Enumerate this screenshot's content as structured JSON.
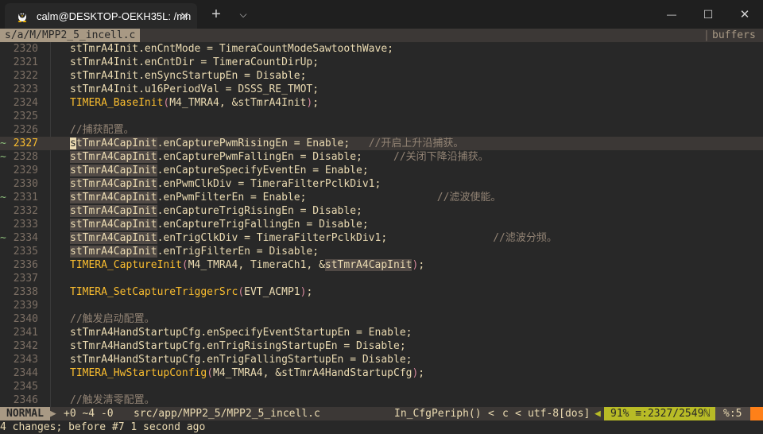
{
  "window": {
    "tab_title": "calm@DESKTOP-OEKH35L: /mn",
    "tab_close": "✕",
    "new_tab": "+",
    "dropdown": "⌵",
    "minimize": "—",
    "maximize": "☐",
    "close": "✕"
  },
  "tabline": {
    "buffer_name": "s/a/M/MPP2_5_incell.c",
    "separator": "|",
    "buffers_label": "buffers"
  },
  "lines": [
    {
      "num": "2320",
      "sign": "",
      "text": "stTmrA4Init.enCntMode = TimeraCountModeSawtoothWave;"
    },
    {
      "num": "2321",
      "sign": "",
      "text": "stTmrA4Init.enCntDir = TimeraCountDirUp;"
    },
    {
      "num": "2322",
      "sign": "",
      "text": "stTmrA4Init.enSyncStartupEn = Disable;"
    },
    {
      "num": "2323",
      "sign": "",
      "text": "stTmrA4Init.u16PeriodVal = DSSS_RE_TMOT;"
    },
    {
      "num": "2324",
      "sign": "",
      "text": "TIMERA_BaseInit(M4_TMRA4, &stTmrA4Init);"
    },
    {
      "num": "2325",
      "sign": "",
      "text": ""
    },
    {
      "num": "2326",
      "sign": "",
      "text": "//捕获配置。"
    },
    {
      "num": "2327",
      "sign": "~",
      "text": "stTmrA4CapInit.enCapturePwmRisingEn = Enable;   //开启上升沿捕获。"
    },
    {
      "num": "2328",
      "sign": "~",
      "text": "stTmrA4CapInit.enCapturePwmFallingEn = Disable;     //关闭下降沿捕获。"
    },
    {
      "num": "2329",
      "sign": "",
      "text": "stTmrA4CapInit.enCaptureSpecifyEventEn = Enable;"
    },
    {
      "num": "2330",
      "sign": "",
      "text": "stTmrA4CapInit.enPwmClkDiv = TimeraFilterPclkDiv1;"
    },
    {
      "num": "2331",
      "sign": "~",
      "text": "stTmrA4CapInit.enPwmFilterEn = Enable;                     //滤波使能。"
    },
    {
      "num": "2332",
      "sign": "",
      "text": "stTmrA4CapInit.enCaptureTrigRisingEn = Disable;"
    },
    {
      "num": "2333",
      "sign": "",
      "text": "stTmrA4CapInit.enCaptureTrigFallingEn = Disable;"
    },
    {
      "num": "2334",
      "sign": "~",
      "text": "stTmrA4CapInit.enTrigClkDiv = TimeraFilterPclkDiv1;                 //滤波分频。"
    },
    {
      "num": "2335",
      "sign": "",
      "text": "stTmrA4CapInit.enTrigFilterEn = Disable;"
    },
    {
      "num": "2336",
      "sign": "",
      "text": "TIMERA_CaptureInit(M4_TMRA4, TimeraCh1, &stTmrA4CapInit);"
    },
    {
      "num": "2337",
      "sign": "",
      "text": ""
    },
    {
      "num": "2338",
      "sign": "",
      "text": "TIMERA_SetCaptureTriggerSrc(EVT_ACMP1);"
    },
    {
      "num": "2339",
      "sign": "",
      "text": ""
    },
    {
      "num": "2340",
      "sign": "",
      "text": "//触发启动配置。"
    },
    {
      "num": "2341",
      "sign": "",
      "text": "stTmrA4HandStartupCfg.enSpecifyEventStartupEn = Enable;"
    },
    {
      "num": "2342",
      "sign": "",
      "text": "stTmrA4HandStartupCfg.enTrigRisingStartupEn = Disable;"
    },
    {
      "num": "2343",
      "sign": "",
      "text": "stTmrA4HandStartupCfg.enTrigFallingStartupEn = Disable;"
    },
    {
      "num": "2344",
      "sign": "",
      "text": "TIMERA_HwStartupConfig(M4_TMRA4, &stTmrA4HandStartupCfg);"
    },
    {
      "num": "2345",
      "sign": "",
      "text": ""
    },
    {
      "num": "2346",
      "sign": "",
      "text": "//触发清零配置。"
    }
  ],
  "current_line": "2327",
  "status": {
    "mode": "NORMAL",
    "hunks": "+0 ~4 -0",
    "file_path": "src/app/MPP2_5/MPP2_5_incell.c",
    "function": "In_CfgPeriph()",
    "lt": "<",
    "filetype": "c",
    "lt2": "<",
    "encoding": "utf-8[dos]",
    "position": "91% ≡:2327/2549ℕ",
    "whitespace": "%:5"
  },
  "message": "4 changes; before #7  1 second ago",
  "colors": {
    "background": "#282828",
    "mode_bg": "#a89984",
    "position_bg": "#b8bb26",
    "warning": "#fe8019",
    "function_yellow": "#fabd2f",
    "comment_gray": "#928374"
  }
}
